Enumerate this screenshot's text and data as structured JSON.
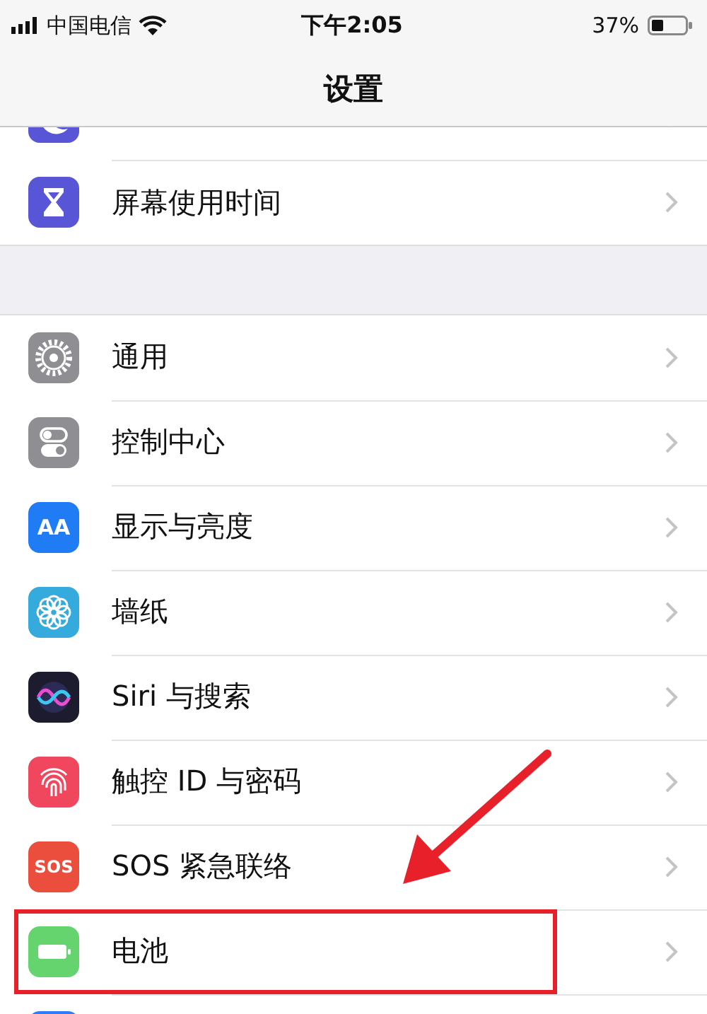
{
  "status_bar": {
    "carrier": "中国电信",
    "time": "下午2:05",
    "battery": "37%"
  },
  "nav": {
    "title": "设置"
  },
  "groups": [
    {
      "items": [
        {
          "kind": "dnd",
          "highlighted": false
        },
        {
          "kind": "screen-time",
          "label": "屏幕使用时间",
          "highlighted": false
        }
      ]
    },
    {
      "items": [
        {
          "kind": "general",
          "label": "通用",
          "highlighted": false
        },
        {
          "kind": "control-center",
          "label": "控制中心",
          "highlighted": false
        },
        {
          "kind": "display",
          "icon_text": "AA",
          "label": "显示与亮度",
          "highlighted": false
        },
        {
          "kind": "wallpaper",
          "label": "墙纸",
          "highlighted": false
        },
        {
          "kind": "siri",
          "label": "Siri 与搜索",
          "highlighted": false
        },
        {
          "kind": "touch-id",
          "label": "触控 ID 与密码",
          "highlighted": false
        },
        {
          "kind": "sos",
          "icon_text": "SOS",
          "label": "SOS 紧急联络",
          "highlighted": false
        },
        {
          "kind": "battery",
          "label": "电池",
          "highlighted": true
        },
        {
          "kind": "privacy",
          "highlighted": false
        }
      ]
    }
  ]
}
